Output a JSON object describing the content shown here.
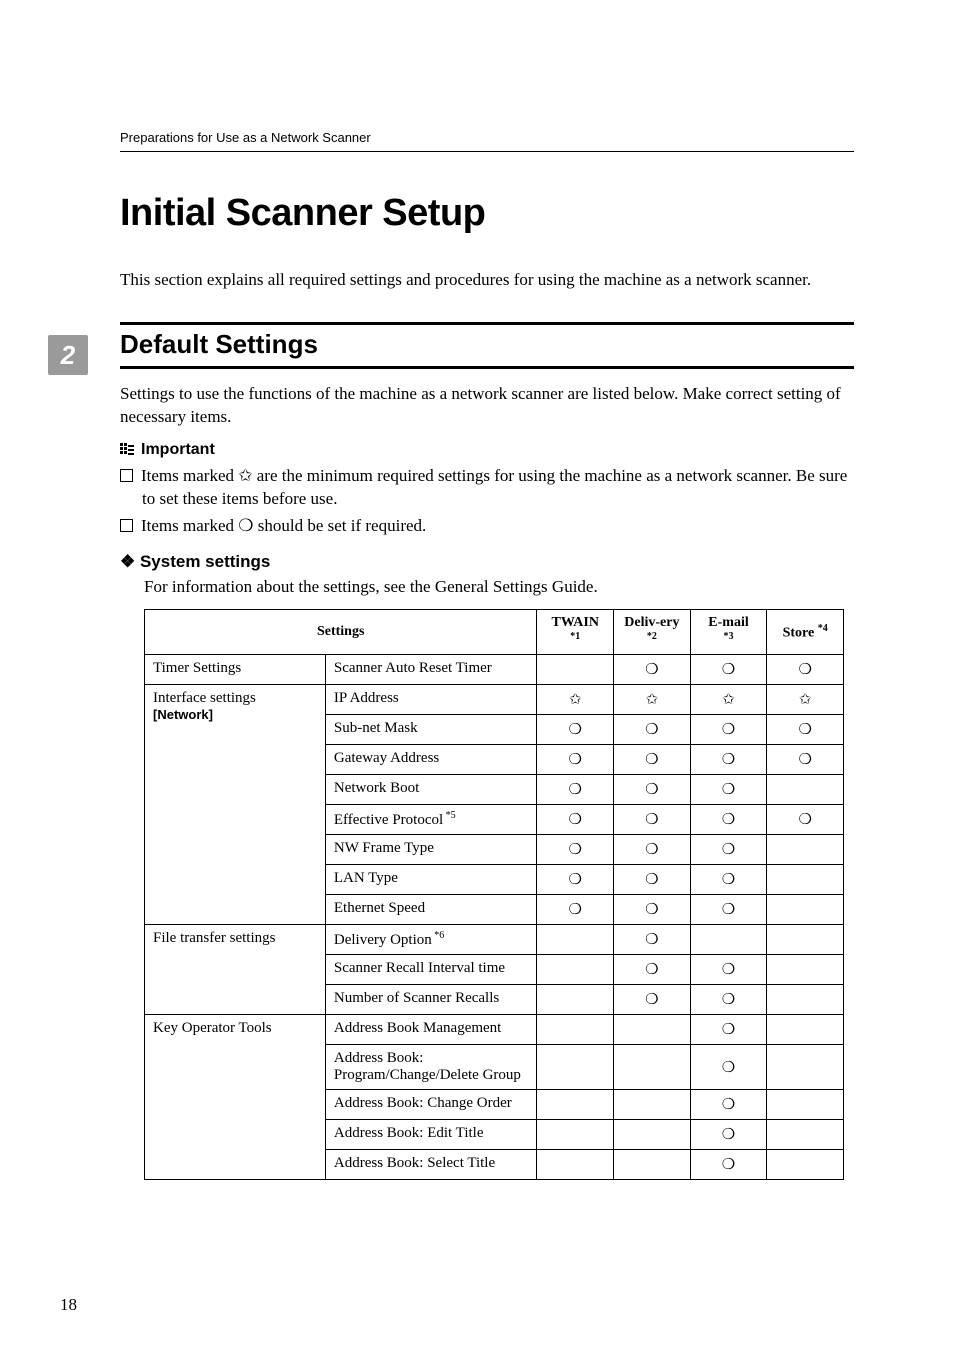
{
  "running_head": "Preparations for Use as a Network Scanner",
  "side_tab": "2",
  "page_number": "18",
  "main_title": "Initial Scanner Setup",
  "intro": "This section explains all required settings and procedures for using the machine as a network scanner.",
  "section_title": "Default Settings",
  "section_body": "Settings to use the functions of the machine as a network scanner are listed below. Make correct setting of necessary items.",
  "important_label": "Important",
  "important_items": [
    "Items marked ✩ are the minimum required settings for using the machine as a network scanner. Be sure to set these items before use.",
    "Items marked ❍ should be set if required."
  ],
  "system_settings_title": "System settings",
  "system_settings_note": "For information about the settings, see the General Settings Guide.",
  "table": {
    "head": {
      "settings": "Settings",
      "twain": "TWAIN",
      "twain_sup": "*1",
      "delivery": "Deliv-ery",
      "delivery_sup": "*2",
      "email": "E-mail",
      "email_sup": "*3",
      "store": "Store",
      "store_sup": "*4"
    },
    "groups": [
      {
        "category": "Timer Settings",
        "category_extra": "",
        "rows": [
          {
            "item": "Scanner Auto Reset Timer",
            "sup": "",
            "twain": "",
            "delivery": "❍",
            "email": "❍",
            "store": "❍"
          }
        ]
      },
      {
        "category": "Interface settings",
        "category_extra": "[Network]",
        "rows": [
          {
            "item": "IP Address",
            "sup": "",
            "twain": "✩",
            "delivery": "✩",
            "email": "✩",
            "store": "✩"
          },
          {
            "item": "Sub-net Mask",
            "sup": "",
            "twain": "❍",
            "delivery": "❍",
            "email": "❍",
            "store": "❍"
          },
          {
            "item": "Gateway Address",
            "sup": "",
            "twain": "❍",
            "delivery": "❍",
            "email": "❍",
            "store": "❍"
          },
          {
            "item": "Network Boot",
            "sup": "",
            "twain": "❍",
            "delivery": "❍",
            "email": "❍",
            "store": ""
          },
          {
            "item": "Effective Protocol",
            "sup": "*5",
            "twain": "❍",
            "delivery": "❍",
            "email": "❍",
            "store": "❍"
          },
          {
            "item": "NW Frame Type",
            "sup": "",
            "twain": "❍",
            "delivery": "❍",
            "email": "❍",
            "store": ""
          },
          {
            "item": "LAN Type",
            "sup": "",
            "twain": "❍",
            "delivery": "❍",
            "email": "❍",
            "store": ""
          },
          {
            "item": "Ethernet Speed",
            "sup": "",
            "twain": "❍",
            "delivery": "❍",
            "email": "❍",
            "store": ""
          }
        ]
      },
      {
        "category": "File transfer settings",
        "category_extra": "",
        "rows": [
          {
            "item": "Delivery Option",
            "sup": "*6",
            "twain": "",
            "delivery": "❍",
            "email": "",
            "store": ""
          },
          {
            "item": "Scanner Recall Interval time",
            "sup": "",
            "twain": "",
            "delivery": "❍",
            "email": "❍",
            "store": ""
          },
          {
            "item": "Number of Scanner Recalls",
            "sup": "",
            "twain": "",
            "delivery": "❍",
            "email": "❍",
            "store": ""
          }
        ]
      },
      {
        "category": "Key Operator Tools",
        "category_extra": "",
        "rows": [
          {
            "item": "Address Book Management",
            "sup": "",
            "twain": "",
            "delivery": "",
            "email": "❍",
            "store": ""
          },
          {
            "item": "Address Book: Program/Change/Delete Group",
            "sup": "",
            "twain": "",
            "delivery": "",
            "email": "❍",
            "store": ""
          },
          {
            "item": "Address Book: Change Order",
            "sup": "",
            "twain": "",
            "delivery": "",
            "email": "❍",
            "store": ""
          },
          {
            "item": "Address Book: Edit Title",
            "sup": "",
            "twain": "",
            "delivery": "",
            "email": "❍",
            "store": ""
          },
          {
            "item": "Address Book: Select Title",
            "sup": "",
            "twain": "",
            "delivery": "",
            "email": "❍",
            "store": ""
          }
        ]
      }
    ]
  }
}
